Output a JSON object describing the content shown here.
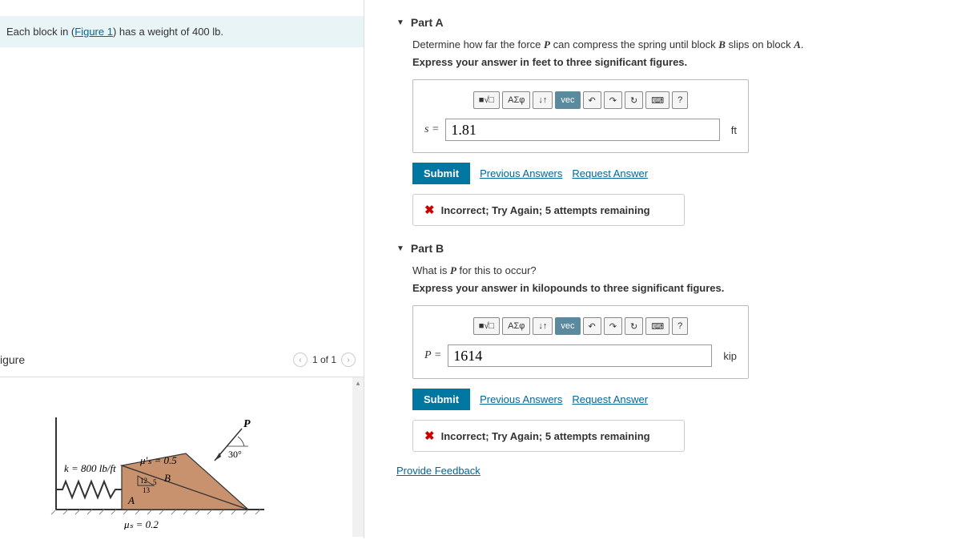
{
  "problem": {
    "prefix": "Each block in (",
    "figure_link": "Figure 1",
    "suffix": ") has a weight of 400 lb."
  },
  "figure": {
    "label": "igure",
    "nav_text": "1 of 1",
    "k_label": "k = 800 lb/ft",
    "mu_prime": "μ′ₛ = 0.5",
    "mu_s": "μₛ = 0.2",
    "P": "P",
    "angle": "30°",
    "A": "A",
    "B": "B",
    "slope_num": "12",
    "slope_den": "13",
    "slope_side": "5"
  },
  "parts": [
    {
      "title": "Part A",
      "question_before": "Determine how far the force ",
      "question_var1": "P",
      "question_mid": " can compress the spring until block ",
      "question_var2": "B",
      "question_mid2": " slips on block ",
      "question_var3": "A",
      "question_after": ".",
      "instruction": "Express your answer in feet to three significant figures.",
      "prefix_var": "s",
      "equals": " = ",
      "value": "1.81",
      "unit": "ft",
      "feedback": "Incorrect; Try Again; 5 attempts remaining"
    },
    {
      "title": "Part B",
      "question_before": "What is ",
      "question_var1": "P",
      "question_mid": " for this to occur?",
      "question_var2": "",
      "question_mid2": "",
      "question_var3": "",
      "question_after": "",
      "instruction": "Express your answer in kilopounds to three significant figures.",
      "prefix_var": "P",
      "equals": " = ",
      "value": "1614",
      "unit": "kip",
      "feedback": "Incorrect; Try Again; 5 attempts remaining"
    }
  ],
  "toolbar": {
    "templates": "■√□",
    "greek": "ΑΣφ",
    "subscript": "↓↑",
    "vec": "vec",
    "undo": "↶",
    "redo": "↷",
    "reset": "↻",
    "keyboard": "⌨",
    "help": "?"
  },
  "actions": {
    "submit": "Submit",
    "previous": "Previous Answers",
    "request": "Request Answer"
  },
  "provide_feedback": "Provide Feedback"
}
